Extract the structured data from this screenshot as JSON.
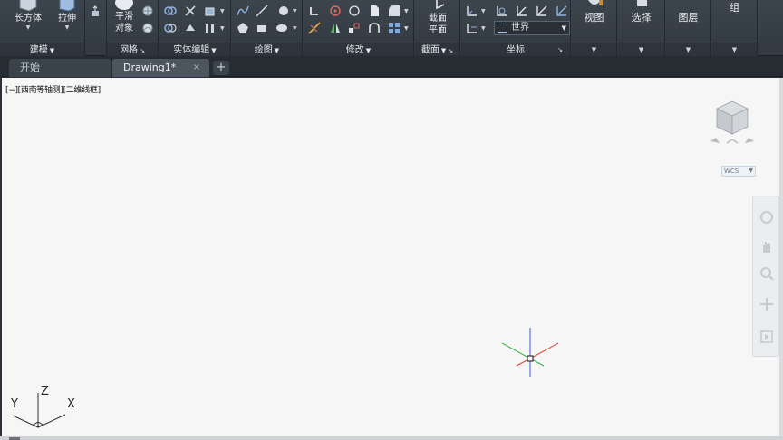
{
  "ribbon": {
    "panels": {
      "modeling": {
        "title": "建模",
        "box_label": "长方体",
        "extrude_label": "拉伸"
      },
      "mesh": {
        "title": "网格",
        "smooth_label_1": "平滑",
        "smooth_label_2": "对象"
      },
      "solid_edit": {
        "title": "实体编辑"
      },
      "draw": {
        "title": "绘图"
      },
      "modify": {
        "title": "修改"
      },
      "section": {
        "title": "截面",
        "plane_label_1": "截面",
        "plane_label_2": "平面"
      },
      "coordinates": {
        "title": "坐标",
        "ucs_combo_value": "世界"
      },
      "view": {
        "label": "视图"
      },
      "selection": {
        "label": "选择"
      },
      "layers": {
        "label": "图层"
      },
      "groups": {
        "label": "组"
      }
    }
  },
  "tabs": {
    "start_label": "开始",
    "doc_label": "Drawing1*",
    "close_glyph": "×",
    "add_glyph": "+"
  },
  "viewport": {
    "label": "[−][西南等轴测][二维线框]",
    "wcs_label": "WCS",
    "ucs_axes": {
      "x": "X",
      "y": "Y",
      "z": "Z"
    }
  },
  "colors": {
    "ribbon_bg": "#353c44",
    "canvas_bg": "#f6f6f6",
    "axis_x": "#d94b3a",
    "axis_y": "#3bb34a",
    "axis_z": "#3b5bdb"
  },
  "icons": {
    "tab_close": "close-icon",
    "tab_add": "plus-icon",
    "viewcube": "viewcube-icon",
    "ucs": "ucs-icon",
    "crosshair": "crosshair-icon"
  }
}
